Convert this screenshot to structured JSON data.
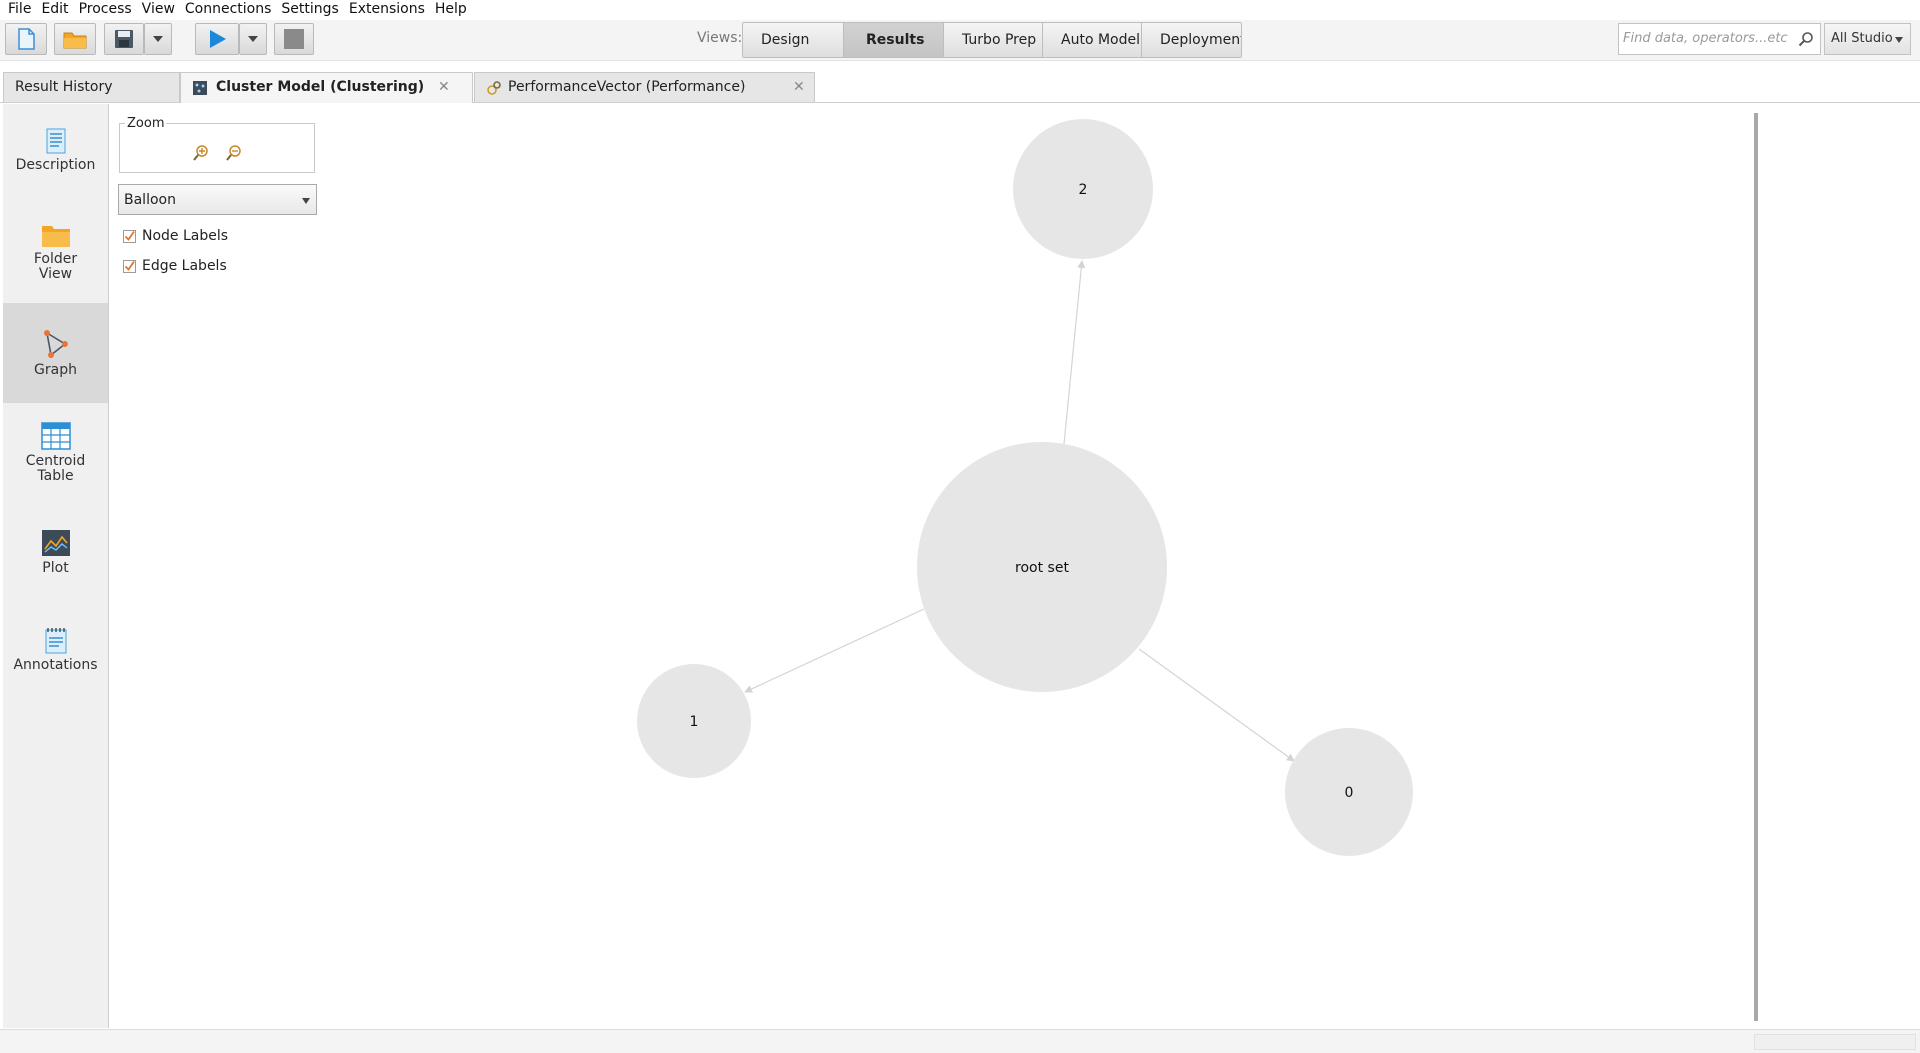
{
  "menu": {
    "items": [
      "File",
      "Edit",
      "Process",
      "View",
      "Connections",
      "Settings",
      "Extensions",
      "Help"
    ]
  },
  "toolbar": {
    "views_label": "Views:",
    "views": [
      {
        "label": "Design",
        "active": false
      },
      {
        "label": "Results",
        "active": true
      },
      {
        "label": "Turbo Prep",
        "active": false
      },
      {
        "label": "Auto Model",
        "active": false
      },
      {
        "label": "Deployments",
        "active": false
      }
    ],
    "search_placeholder": "Find data, operators...etc",
    "scope_selected": "All Studio"
  },
  "tabs": [
    {
      "label": "Result History",
      "active": false,
      "closable": false
    },
    {
      "label": "Cluster Model (Clustering)",
      "active": true,
      "closable": true,
      "icon": "cluster-model-icon"
    },
    {
      "label": "PerformanceVector (Performance)",
      "active": false,
      "closable": true,
      "icon": "performance-icon"
    }
  ],
  "close_glyph": "✕",
  "sidebar": {
    "items": [
      {
        "label_line1": "Description",
        "label_line2": "",
        "icon": "description-icon",
        "active": false
      },
      {
        "label_line1": "Folder",
        "label_line2": "View",
        "icon": "folder-icon",
        "active": false
      },
      {
        "label_line1": "Graph",
        "label_line2": "",
        "icon": "graph-icon",
        "active": true
      },
      {
        "label_line1": "Centroid",
        "label_line2": "Table",
        "icon": "table-icon",
        "active": false
      },
      {
        "label_line1": "Plot",
        "label_line2": "",
        "icon": "plot-icon",
        "active": false
      },
      {
        "label_line1": "Annotations",
        "label_line2": "",
        "icon": "annotations-icon",
        "active": false
      }
    ]
  },
  "graph_controls": {
    "zoom_title": "Zoom",
    "layout_selected": "Balloon",
    "node_labels": {
      "label": "Node Labels",
      "checked": true
    },
    "edge_labels": {
      "label": "Edge Labels",
      "checked": true
    }
  },
  "graph": {
    "nodes": [
      {
        "id": "root",
        "label": "root set"
      },
      {
        "id": "c2",
        "label": "2"
      },
      {
        "id": "c1",
        "label": "1"
      },
      {
        "id": "c0",
        "label": "0"
      }
    ],
    "edges": [
      {
        "from": "root",
        "to": "c2"
      },
      {
        "from": "root",
        "to": "c1"
      },
      {
        "from": "root",
        "to": "c0"
      }
    ],
    "node_fill": "#e6e6e6",
    "edge_color": "#d4d4d4"
  },
  "colors": {
    "accent_blue": "#1e88d8",
    "folder_orange": "#f2a623"
  }
}
